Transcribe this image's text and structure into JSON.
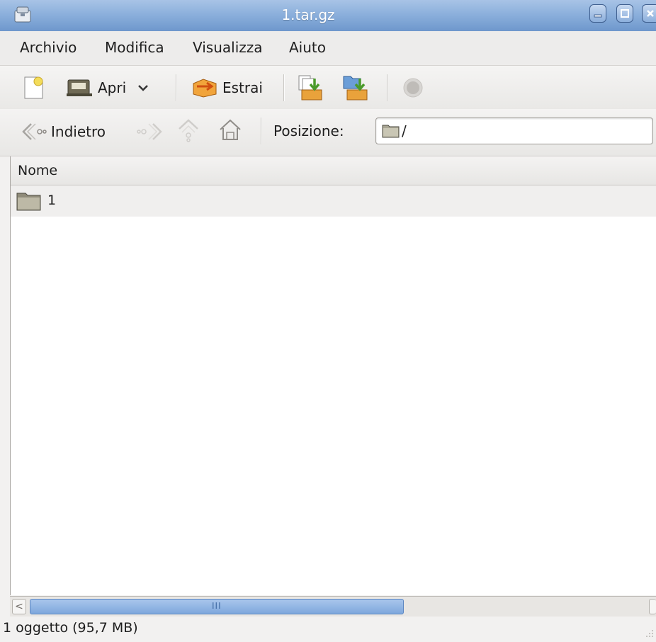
{
  "window": {
    "title": "1.tar.gz"
  },
  "menu": [
    "Archivio",
    "Modifica",
    "Visualizza",
    "Aiuto"
  ],
  "toolbar": {
    "open_label": "Apri",
    "extract_label": "Estrai"
  },
  "location_bar": {
    "back_label": "Indietro",
    "location_label": "Posizione:",
    "location_value": "/"
  },
  "file_list": {
    "column_name": "Nome",
    "rows": [
      {
        "name": "1",
        "icon": "folder-icon"
      }
    ]
  },
  "scrollbar": {
    "thumb_grip": "III"
  },
  "status": {
    "text": "1 oggetto (95,7 MB)"
  },
  "colors": {
    "titlebar": "#8cb0dc",
    "scroll_thumb": "#8fb4e4"
  }
}
